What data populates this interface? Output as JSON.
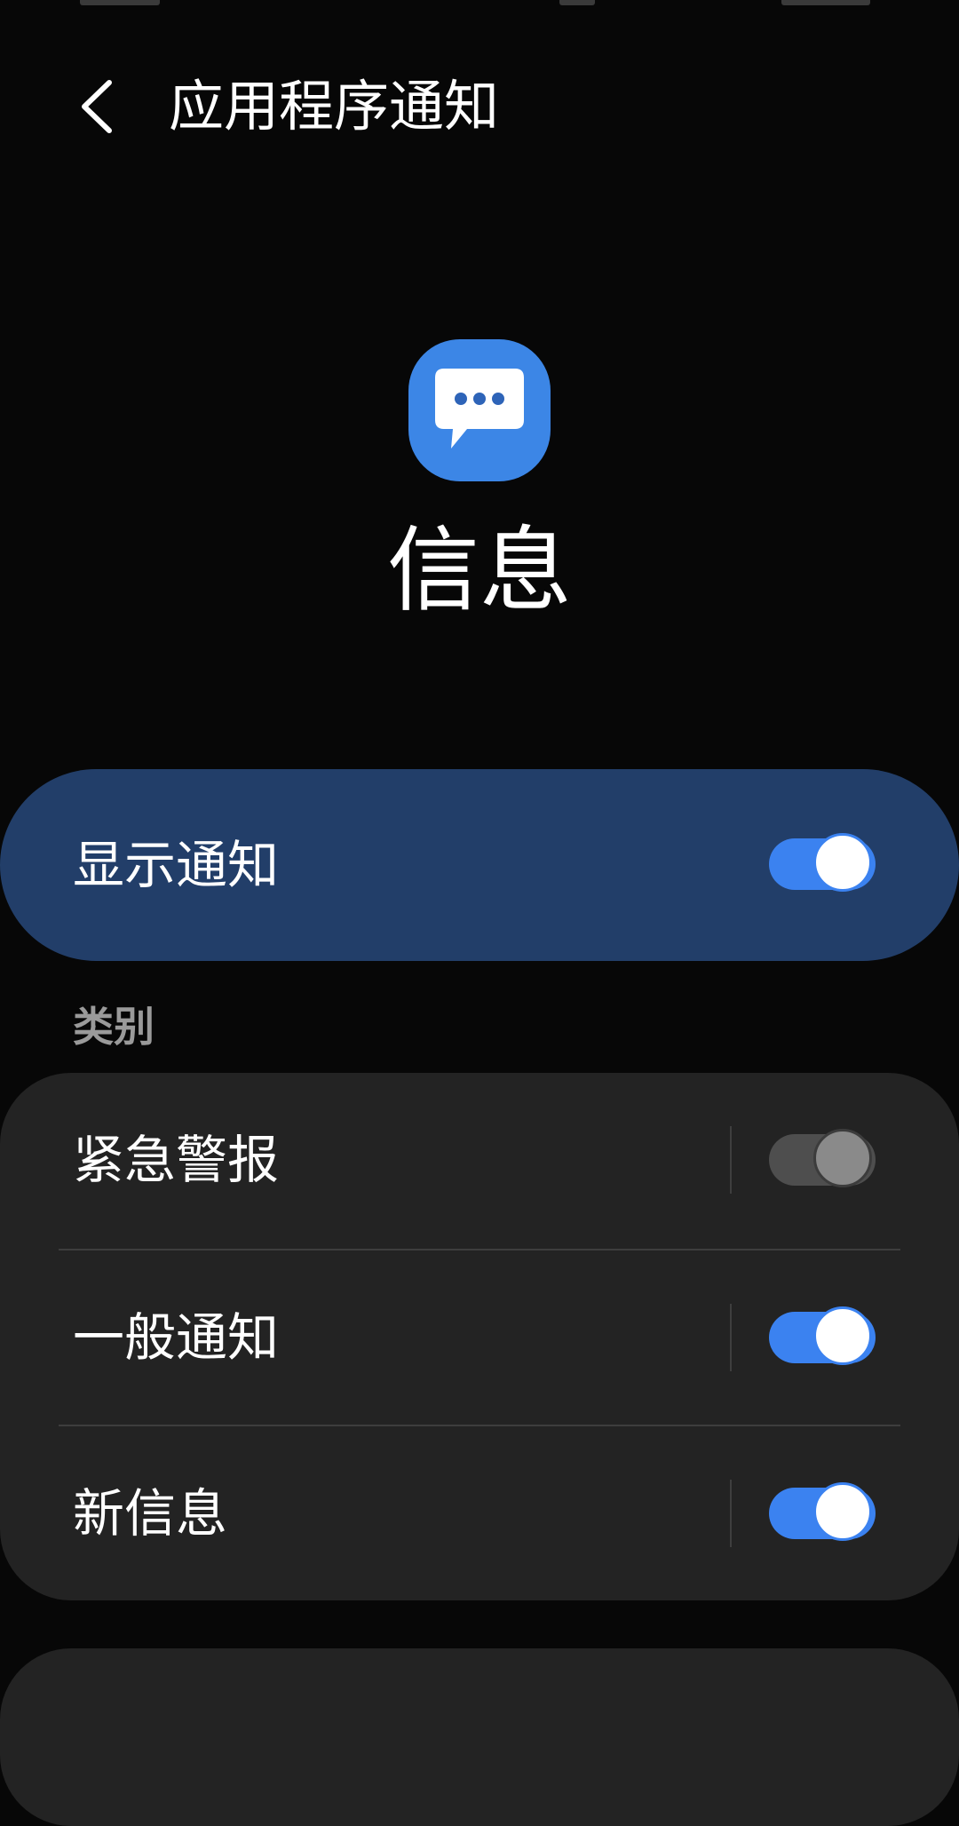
{
  "header": {
    "title": "应用程序通知",
    "back_icon": "chevron-left-icon"
  },
  "app": {
    "name": "信息",
    "icon": "messages-icon",
    "icon_color": "#3c86e6"
  },
  "master": {
    "label": "显示通知",
    "enabled": true,
    "card_color": "#223e69"
  },
  "categories": {
    "section_label": "类别",
    "items": [
      {
        "label": "紧急警报",
        "enabled": false
      },
      {
        "label": "一般通知",
        "enabled": true
      },
      {
        "label": "新信息",
        "enabled": true
      }
    ]
  },
  "colors": {
    "accent": "#3b82f0",
    "background": "#070707",
    "card": "#232323"
  }
}
